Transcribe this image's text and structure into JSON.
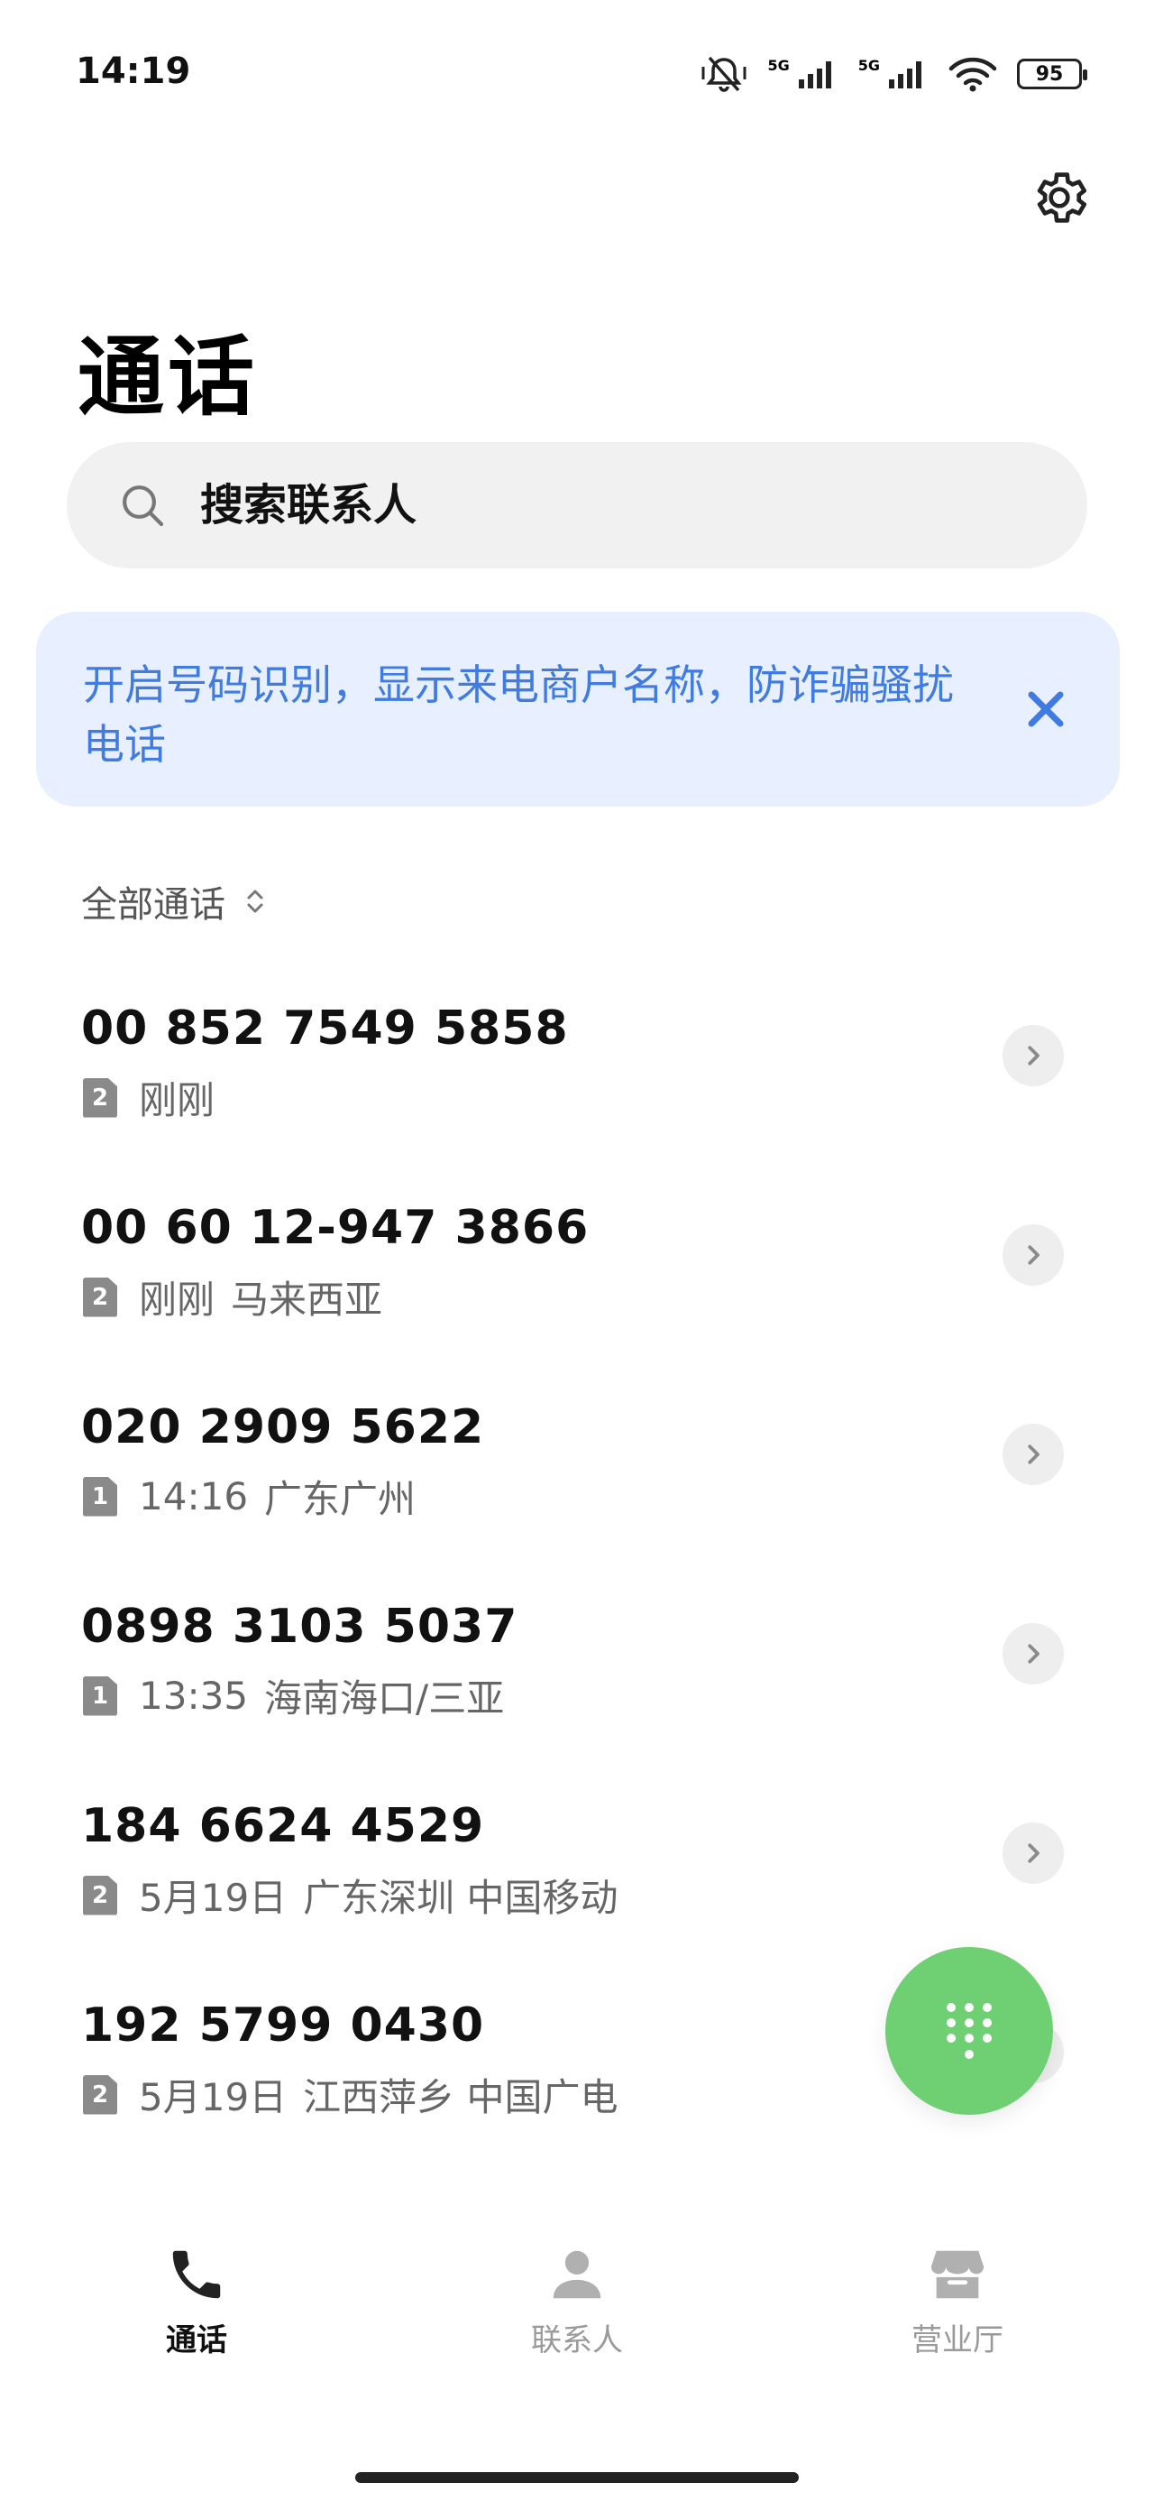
{
  "status_bar": {
    "time": "14:19",
    "battery": "95",
    "network_1": "5G",
    "network_2": "5G"
  },
  "header": {
    "title": "通话"
  },
  "search": {
    "placeholder": "搜索联系人"
  },
  "banner": {
    "text": "开启号码识别，显示来电商户名称，防诈骗骚扰电话"
  },
  "filter": {
    "label": "全部通话"
  },
  "calls": [
    {
      "number": "00 852 7549 5858",
      "sim": "2",
      "time": "刚刚",
      "location": ""
    },
    {
      "number": "00 60 12-947 3866",
      "sim": "2",
      "time": "刚刚",
      "location": "马来西亚"
    },
    {
      "number": "020 2909 5622",
      "sim": "1",
      "time": "14:16",
      "location": "广东广州"
    },
    {
      "number": "0898 3103 5037",
      "sim": "1",
      "time": "13:35",
      "location": "海南海口/三亚"
    },
    {
      "number": "184 6624 4529",
      "sim": "2",
      "time": "5月19日",
      "location": "广东深圳 中国移动"
    },
    {
      "number": "192 5799 0430",
      "sim": "2",
      "time": "5月19日",
      "location": "江西萍乡 中国广电"
    }
  ],
  "tabs": [
    {
      "label": "通话",
      "icon": "phone-icon",
      "active": true
    },
    {
      "label": "联系人",
      "icon": "person-icon",
      "active": false
    },
    {
      "label": "营业厅",
      "icon": "store-icon",
      "active": false
    }
  ],
  "colors": {
    "accent_blue": "#3f7be0",
    "banner_bg": "#e8efff",
    "fab_green": "#6fcf73"
  }
}
